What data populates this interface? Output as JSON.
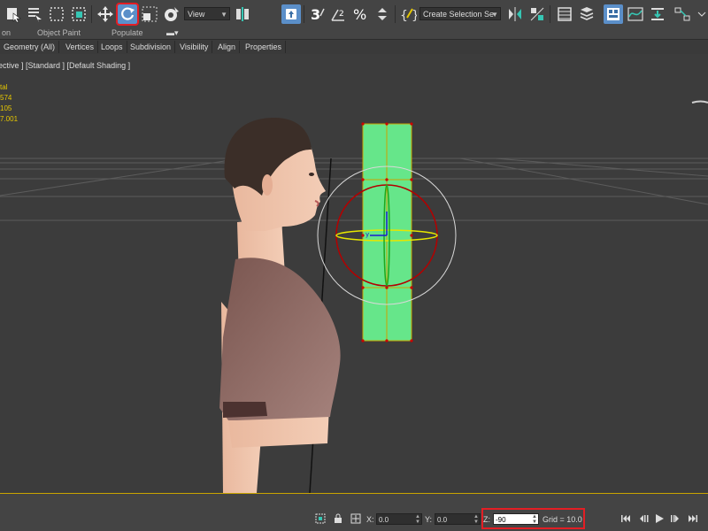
{
  "toolbar": {
    "view_dropdown": "View",
    "selection_set_dropdown": "Create Selection Se",
    "snap_toggle": "3",
    "angle_snap_label": "2",
    "colors": {
      "accent": "#5b8fc9",
      "highlight_red": "#e31e24"
    }
  },
  "ribbon": {
    "top_labels": [
      "on",
      "Object Paint",
      "Populate"
    ],
    "tabs": [
      "Geometry (All)",
      "Vertices",
      "Loops",
      "Subdivision",
      "Visibility",
      "Align",
      "Properties"
    ]
  },
  "viewport": {
    "label": "ective ] [Standard ] [Default Shading ]",
    "stats": [
      "tal",
      "574",
      "105",
      "",
      "7.001"
    ],
    "gizmo_axis_label": "y",
    "colors": {
      "selected_object": "#66e68a",
      "grid_line": "#6a6a6a"
    }
  },
  "statusbar": {
    "x_label": "X:",
    "x_value": "0.0",
    "y_label": "Y:",
    "y_value": "0.0",
    "z_label": "Z:",
    "z_value": "-90",
    "grid": "Grid = 10.0"
  }
}
